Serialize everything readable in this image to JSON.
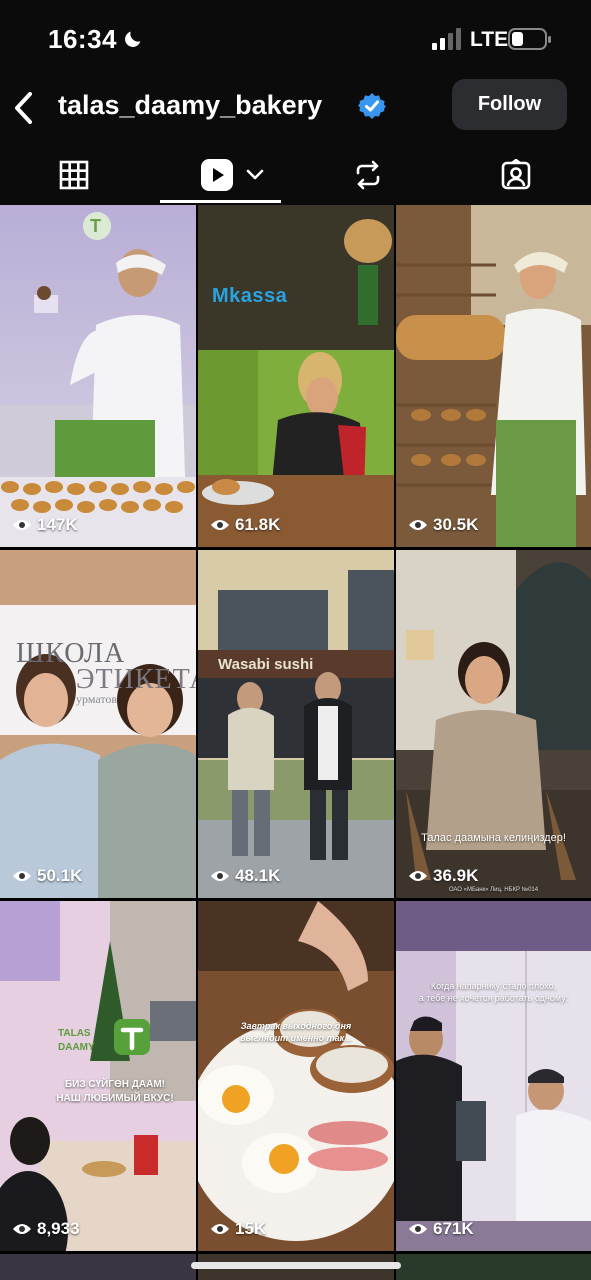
{
  "status_bar": {
    "time": "16:34",
    "network": "LTE"
  },
  "header": {
    "username": "talas_daamy_bakery",
    "follow_label": "Follow"
  },
  "tabs": [
    {
      "name": "grid",
      "icon": "grid-icon"
    },
    {
      "name": "reels",
      "icon": "reels-icon",
      "active": true
    },
    {
      "name": "reposts",
      "icon": "repost-icon"
    },
    {
      "name": "tagged",
      "icon": "tagged-icon"
    }
  ],
  "posts": [
    {
      "views": "147K",
      "logo": "T"
    },
    {
      "views": "61.8K",
      "brand": "Мkassa"
    },
    {
      "views": "30.5K"
    },
    {
      "views": "50.1K",
      "sign_line1": "ШКОЛА",
      "sign_line2": "ЭТИКЕТА",
      "sign_line3": "урматов"
    },
    {
      "views": "48.1K",
      "storefront": "Wasabi sushi"
    },
    {
      "views": "36.9K",
      "caption": "Талас даамына келиңиздер!",
      "footnote": "ОАО «МБанк» Лиц. НБКР №014"
    },
    {
      "views": "8,933",
      "wall_text": "TALAS DAAMY",
      "caption_line1": "БИЗ СҮЙГӨН ДААМ!",
      "caption_line2": "НАШ ЛЮБИМЫЙ ВКУС!"
    },
    {
      "views": "15K",
      "caption_line1": "Завтрак выходного дня",
      "caption_line2": "выглядит именно так..."
    },
    {
      "views": "671K",
      "caption_line1": "Когда напарнику стало плохо,",
      "caption_line2": "а тебе не хочется работать одному:"
    }
  ],
  "colors": {
    "verified": "#3797f0",
    "follow_bg": "#2b2d30",
    "background": "#000000"
  }
}
